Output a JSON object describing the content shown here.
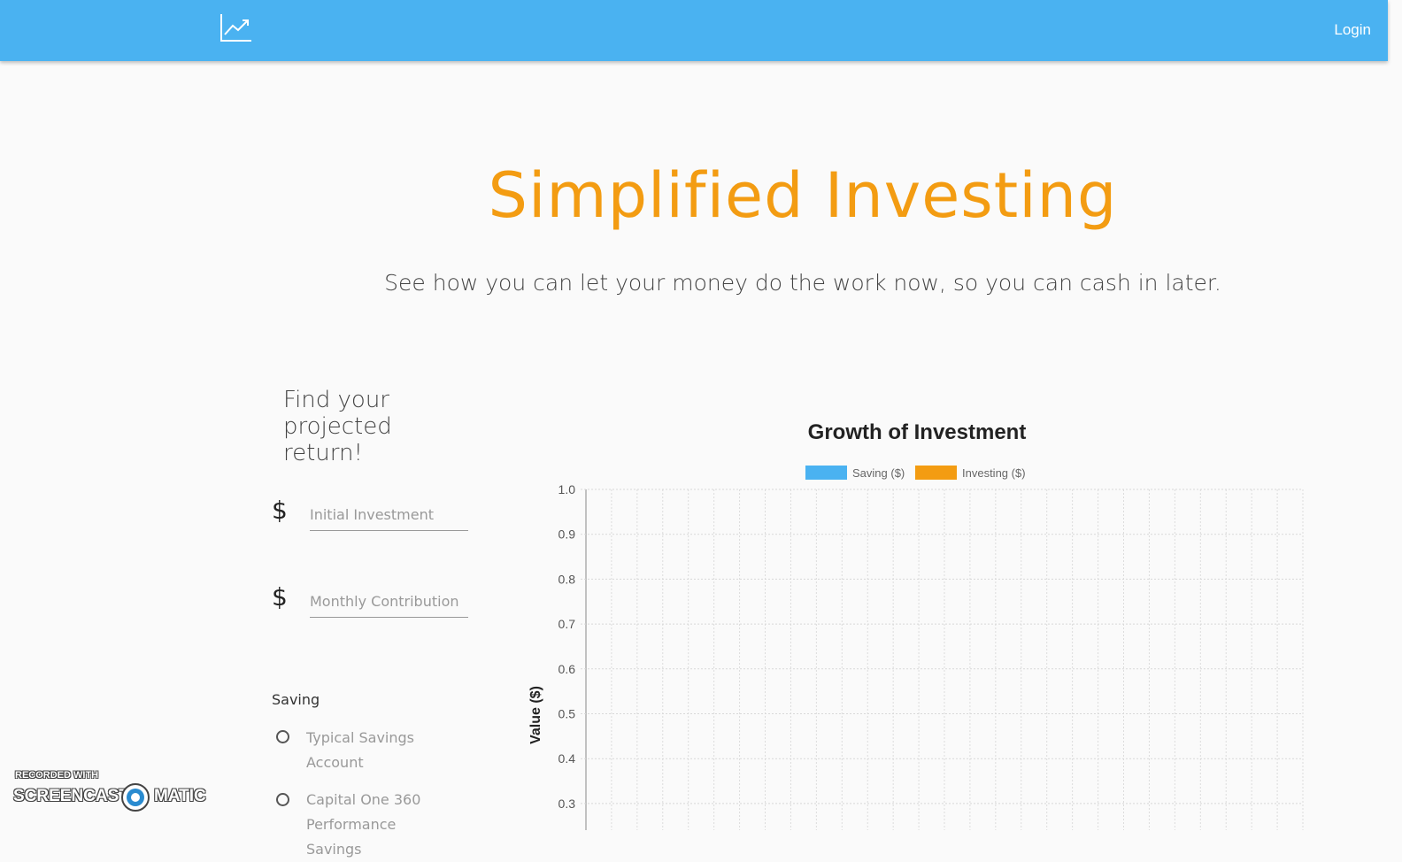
{
  "nav": {
    "logo_icon": "trending-up-icon",
    "login_label": "Login",
    "background": "#4ab2f1"
  },
  "hero": {
    "title": "Simplified Investing",
    "subtitle": "See how you can let your money do the work now, so you can cash in later.",
    "title_color": "#f39c12"
  },
  "form": {
    "heading": "Find your projected return!",
    "currency_symbol": "$",
    "initial_placeholder": "Initial Investment",
    "monthly_placeholder": "Monthly Contribution",
    "saving_group_label": "Saving",
    "saving_options": [
      "Typical Savings Account",
      "Capital One 360 Performance Savings"
    ]
  },
  "chart_data": {
    "type": "bar",
    "title": "Growth of Investment",
    "xlabel": "",
    "ylabel": "Value ($)",
    "ylim": [
      0.3,
      1.0
    ],
    "y_ticks": [
      "1.0",
      "0.9",
      "0.8",
      "0.7",
      "0.6",
      "0.5",
      "0.4",
      "0.3"
    ],
    "series": [
      {
        "name": "Saving ($)",
        "color": "#4ab2f1",
        "values": []
      },
      {
        "name": "Investing ($)",
        "color": "#f39c12",
        "values": []
      }
    ],
    "grid": true,
    "legend_position": "top"
  },
  "watermark": {
    "line1": "RECORDED WITH",
    "left": "SCREENCAST",
    "right": "MATIC"
  }
}
